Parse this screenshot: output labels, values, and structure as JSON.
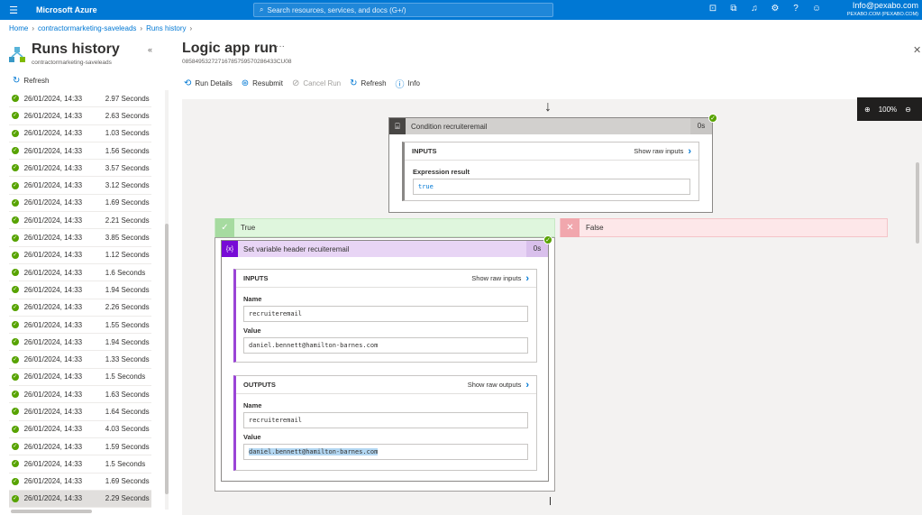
{
  "topbar": {
    "brand": "Microsoft Azure",
    "search_placeholder": "Search resources, services, and docs (G+/)",
    "account_email": "Info@pexabo.com",
    "account_tenant": "PEXABO.COM (PEXABO.COM)"
  },
  "breadcrumb": [
    {
      "label": "Home"
    },
    {
      "label": "contractormarketing-saveleads"
    },
    {
      "label": "Runs history"
    }
  ],
  "left_panel": {
    "title": "Runs history",
    "subtitle": "contractormarketing-saveleads",
    "refresh_label": "Refresh",
    "runs": [
      {
        "date": "26/01/2024, 14:33",
        "duration": "2.97 Seconds"
      },
      {
        "date": "26/01/2024, 14:33",
        "duration": "2.63 Seconds"
      },
      {
        "date": "26/01/2024, 14:33",
        "duration": "1.03 Seconds"
      },
      {
        "date": "26/01/2024, 14:33",
        "duration": "1.56 Seconds"
      },
      {
        "date": "26/01/2024, 14:33",
        "duration": "3.57 Seconds"
      },
      {
        "date": "26/01/2024, 14:33",
        "duration": "3.12 Seconds"
      },
      {
        "date": "26/01/2024, 14:33",
        "duration": "1.69 Seconds"
      },
      {
        "date": "26/01/2024, 14:33",
        "duration": "2.21 Seconds"
      },
      {
        "date": "26/01/2024, 14:33",
        "duration": "3.85 Seconds"
      },
      {
        "date": "26/01/2024, 14:33",
        "duration": "1.12 Seconds"
      },
      {
        "date": "26/01/2024, 14:33",
        "duration": "1.6 Seconds"
      },
      {
        "date": "26/01/2024, 14:33",
        "duration": "1.94 Seconds"
      },
      {
        "date": "26/01/2024, 14:33",
        "duration": "2.26 Seconds"
      },
      {
        "date": "26/01/2024, 14:33",
        "duration": "1.55 Seconds"
      },
      {
        "date": "26/01/2024, 14:33",
        "duration": "1.94 Seconds"
      },
      {
        "date": "26/01/2024, 14:33",
        "duration": "1.33 Seconds"
      },
      {
        "date": "26/01/2024, 14:33",
        "duration": "1.5 Seconds"
      },
      {
        "date": "26/01/2024, 14:33",
        "duration": "1.63 Seconds"
      },
      {
        "date": "26/01/2024, 14:33",
        "duration": "1.64 Seconds"
      },
      {
        "date": "26/01/2024, 14:33",
        "duration": "4.03 Seconds"
      },
      {
        "date": "26/01/2024, 14:33",
        "duration": "1.59 Seconds"
      },
      {
        "date": "26/01/2024, 14:33",
        "duration": "1.5 Seconds"
      },
      {
        "date": "26/01/2024, 14:33",
        "duration": "1.69 Seconds"
      },
      {
        "date": "26/01/2024, 14:33",
        "duration": "2.29 Seconds",
        "selected": true
      }
    ]
  },
  "main": {
    "title": "Logic app run",
    "more_label": "···",
    "run_id": "08584953272716785759570286433CU08",
    "toolbar": {
      "run_details": "Run Details",
      "resubmit": "Resubmit",
      "cancel_run": "Cancel Run",
      "refresh": "Refresh",
      "info": "Info"
    },
    "zoom_level": "100%"
  },
  "condition": {
    "title": "Condition recruiteremail",
    "duration": "0s",
    "inputs_label": "INPUTS",
    "show_raw_inputs": "Show raw inputs",
    "expression_label": "Expression result",
    "expression_value": "true"
  },
  "branches": {
    "true_label": "True",
    "false_label": "False"
  },
  "set_variable": {
    "title": "Set variable header recuiteremail",
    "duration": "0s",
    "inputs_label": "INPUTS",
    "show_raw_inputs": "Show raw inputs",
    "input_name_label": "Name",
    "input_name_value": "recruiteremail",
    "input_value_label": "Value",
    "input_value_value": "daniel.bennett@hamilton-barnes.com",
    "outputs_label": "OUTPUTS",
    "show_raw_outputs": "Show raw outputs",
    "output_name_label": "Name",
    "output_name_value": "recruiteremail",
    "output_value_label": "Value",
    "output_value_value": "daniel.bennett@hamilton-barnes.com"
  },
  "colors": {
    "azure_blue": "#0078d4",
    "success_green": "#57a300",
    "condition_header": "#d2d0ce",
    "condition_icon": "#484644",
    "true_branch": "#dff6dd",
    "false_branch": "#fde7e9",
    "variable_header": "#e8d5f5",
    "variable_icon": "#770bd6"
  }
}
